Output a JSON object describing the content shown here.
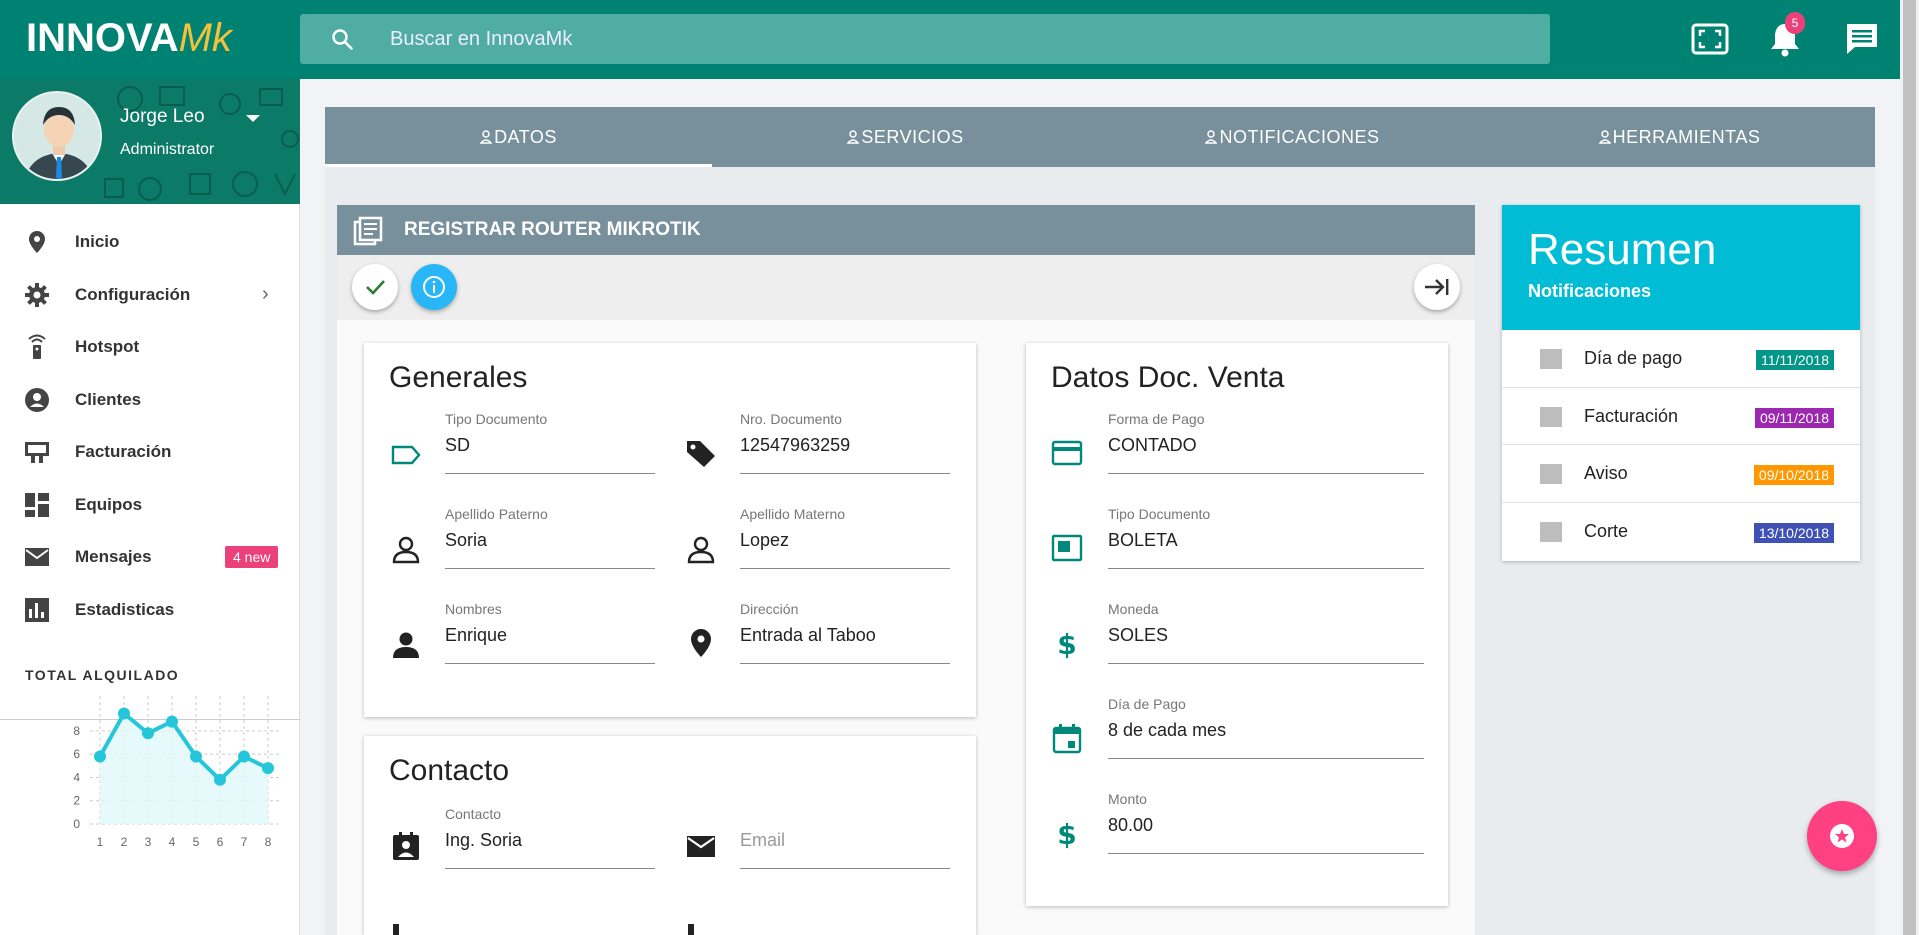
{
  "brand": {
    "part1": "INNOVA",
    "part2": "Mk"
  },
  "search": {
    "placeholder": "Buscar en InnovaMk"
  },
  "topbar": {
    "notification_count": "5",
    "icons": [
      "fullscreen-icon",
      "bell-icon",
      "chat-icon"
    ]
  },
  "user": {
    "name": "Jorge Leo",
    "role": "Administrator"
  },
  "menu": [
    {
      "label": "Inicio",
      "icon": "location-pin-icon"
    },
    {
      "label": "Configuración",
      "icon": "gear-icon",
      "has_submenu": true
    },
    {
      "label": "Hotspot",
      "icon": "wifi-remote-icon"
    },
    {
      "label": "Clientes",
      "icon": "account-circle-icon"
    },
    {
      "label": "Facturación",
      "icon": "billing-icon"
    },
    {
      "label": "Equipos",
      "icon": "dashboard-icon"
    },
    {
      "label": "Mensajes",
      "icon": "mail-icon",
      "badge": "4 new"
    },
    {
      "label": "Estadisticas",
      "icon": "bar-chart-icon"
    }
  ],
  "stats": {
    "label": "TOTAL ALQUILADO",
    "chart_data": {
      "type": "area",
      "x": [
        1,
        2,
        3,
        4,
        5,
        6,
        7,
        8
      ],
      "values": [
        5.8,
        9.5,
        7.8,
        8.8,
        5.8,
        3.8,
        5.8,
        4.8
      ],
      "yticks": [
        0,
        2,
        4,
        6,
        8
      ],
      "xticks": [
        1,
        2,
        3,
        4,
        5,
        6,
        7,
        8
      ],
      "ylim": [
        0,
        11
      ],
      "grid": true,
      "color": "#26c6da"
    }
  },
  "tabs": [
    "DATOS",
    "SERVICIOS",
    "NOTIFICACIONES",
    "HERRAMIENTAS"
  ],
  "panel": {
    "title": "REGISTRAR ROUTER MIKROTIK"
  },
  "generales": {
    "title": "Generales",
    "fields": [
      {
        "label": "Tipo Documento",
        "value": "SD",
        "icon": "label-outline-icon"
      },
      {
        "label": "Nro. Documento",
        "value": "12547963259",
        "icon": "tag-icon"
      },
      {
        "label": "Apellido Paterno",
        "value": "Soria",
        "icon": "person-outline-icon"
      },
      {
        "label": "Apellido Materno",
        "value": "Lopez",
        "icon": "person-outline-icon"
      },
      {
        "label": "Nombres",
        "value": "Enrique",
        "icon": "person-icon"
      },
      {
        "label": "Dirección",
        "value": "Entrada al Taboo",
        "icon": "location-pin-icon"
      }
    ]
  },
  "contacto": {
    "title": "Contacto",
    "fields": [
      {
        "label": "Contacto",
        "value": "Ing. Soria",
        "icon": "contact-card-icon"
      },
      {
        "label": "",
        "placeholder": "Email",
        "icon": "mail-icon"
      }
    ]
  },
  "venta": {
    "title": "Datos Doc. Venta",
    "fields": [
      {
        "label": "Forma de Pago",
        "value": "CONTADO",
        "icon": "credit-card-icon"
      },
      {
        "label": "Tipo Documento",
        "value": "BOLETA",
        "icon": "document-box-icon"
      },
      {
        "label": "Moneda",
        "value": "SOLES",
        "icon": "dollar-icon"
      },
      {
        "label": "Día de Pago",
        "value": "8 de cada mes",
        "icon": "calendar-icon"
      },
      {
        "label": "Monto",
        "value": "80.00",
        "icon": "dollar-icon"
      }
    ]
  },
  "resumen": {
    "title": "Resumen",
    "subtitle": "Notificaciones",
    "items": [
      {
        "label": "Día de pago",
        "date": "11/11/2018",
        "color": "#009688"
      },
      {
        "label": "Facturación",
        "date": "09/11/2018",
        "color": "#9c27b0"
      },
      {
        "label": "Aviso",
        "date": "09/10/2018",
        "color": "#ff9800"
      },
      {
        "label": "Corte",
        "date": "13/10/2018",
        "color": "#3f51b5"
      }
    ]
  },
  "fab": {
    "icon": "star-icon"
  }
}
